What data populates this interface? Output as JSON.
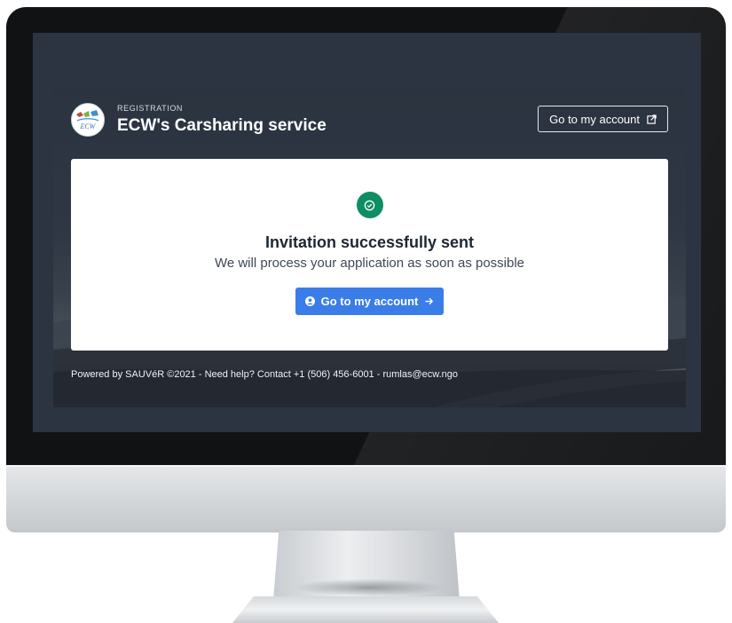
{
  "header": {
    "eyebrow": "REGISTRATION",
    "title": "ECW's Carsharing service",
    "logo_text": "ECW",
    "account_link_label": "Go to my account",
    "account_link_icon": "external-link-icon"
  },
  "confirmation": {
    "status_icon": "check-circle-icon",
    "title": "Invitation successfully sent",
    "subtitle": "We will process your application as soon as possible",
    "button_label": "Go to my account",
    "button_leading_icon": "user-circle-icon",
    "button_trailing_icon": "arrow-right-icon"
  },
  "footer": {
    "text": "Powered by SAUVéR ©2021 - Need help? Contact +1 (506) 456-6001 - rumlas@ecw.ngo"
  },
  "colors": {
    "screen_background": "#2d3441",
    "card_background": "#ffffff",
    "success_green": "#0d8f63",
    "primary_blue": "#3a7de9",
    "heading_text": "#1d2733"
  }
}
